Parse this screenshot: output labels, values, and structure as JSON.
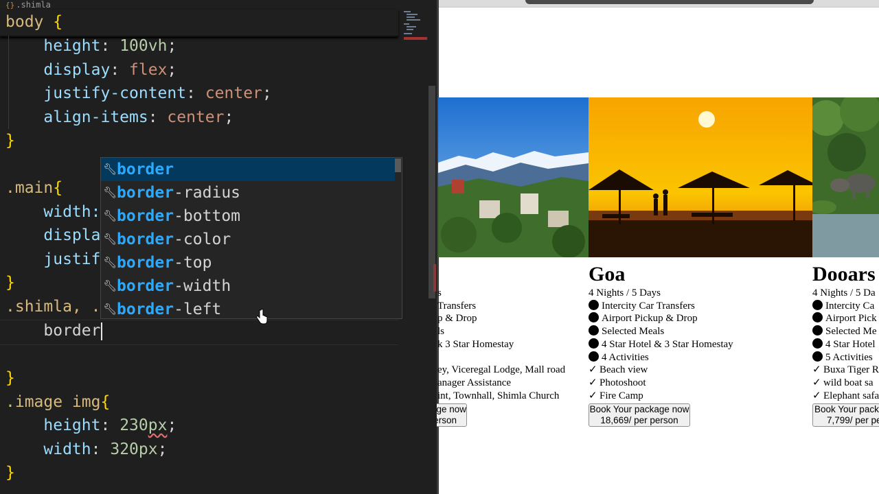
{
  "editor": {
    "tab_label": ".shimla",
    "tab_icon": "css-file-icon",
    "sticky": {
      "selector": "body",
      "brace": "{"
    },
    "lines": {
      "height_prop": "height",
      "height_val": "100vh",
      "display_prop": "display",
      "display_val": "flex",
      "jc_prop": "justify-content",
      "jc_val": "center",
      "ai_prop": "align-items",
      "ai_val": "center",
      "close1": "}",
      "main_sel": ".main",
      "main_brace": "{",
      "width_partial": "width:",
      "displa_partial": "displa",
      "justif_partial": "justif",
      "close2": "}",
      "shimla_sel": ".shimla, .",
      "typed": "border",
      "close3": "}",
      "image_sel": ".image img",
      "image_brace": "{",
      "img_height_prop": "height",
      "img_height_num": "230",
      "img_height_unit": "px",
      "img_width_prop": "width",
      "img_width_num": "320",
      "img_width_unit": "px",
      "close4": "}"
    },
    "suggestions": {
      "match": "border",
      "items": [
        {
          "label": "border",
          "rest": ""
        },
        {
          "label": "border-radius",
          "rest": "-radius"
        },
        {
          "label": "border-bottom",
          "rest": "-bottom"
        },
        {
          "label": "border-color",
          "rest": "-color"
        },
        {
          "label": "border-top",
          "rest": "-top"
        },
        {
          "label": "border-width",
          "rest": "-width"
        },
        {
          "label": "border-left",
          "rest": "-left"
        }
      ]
    }
  },
  "preview": {
    "cards": [
      {
        "title": "",
        "lines": [
          "s",
          "Transfers",
          "p & Drop",
          "ls",
          "k 3 Star Homestay",
          "",
          "ey, Viceregal Lodge, Mall road",
          "anager Assistance",
          "int, Townhall, Shimla Church"
        ],
        "button_line1": "ge now",
        "button_line2": "erson"
      },
      {
        "title": "Goa",
        "nights": "4 Nights / 5 Days",
        "features": [
          "Intercity Car Transfers",
          "Airport Pickup & Drop",
          "Selected Meals",
          "4 Star Hotel & 3 Star Homestay",
          "4 Activities"
        ],
        "highlights": [
          "Beach view",
          "Photoshoot",
          "Fire Camp"
        ],
        "button_line1": "Book Your package now",
        "button_line2": "18,669/ per person"
      },
      {
        "title": "Dooars",
        "nights": "4 Nights / 5 Da",
        "features": [
          "Intercity Ca",
          "Airport Pick",
          "Selected Me",
          "4 Star Hotel",
          "5 Activities"
        ],
        "highlights": [
          "Buxa Tiger R",
          "wild boat sa",
          "Elephant safa"
        ],
        "button_line1": "Book Your pack",
        "button_line2": "7,799/ per pe"
      }
    ],
    "check_glyph": "✓",
    "colors": {
      "sky": "#2a7fd4",
      "sunset": "#f6a300",
      "jungle": "#3f6b2a"
    }
  }
}
